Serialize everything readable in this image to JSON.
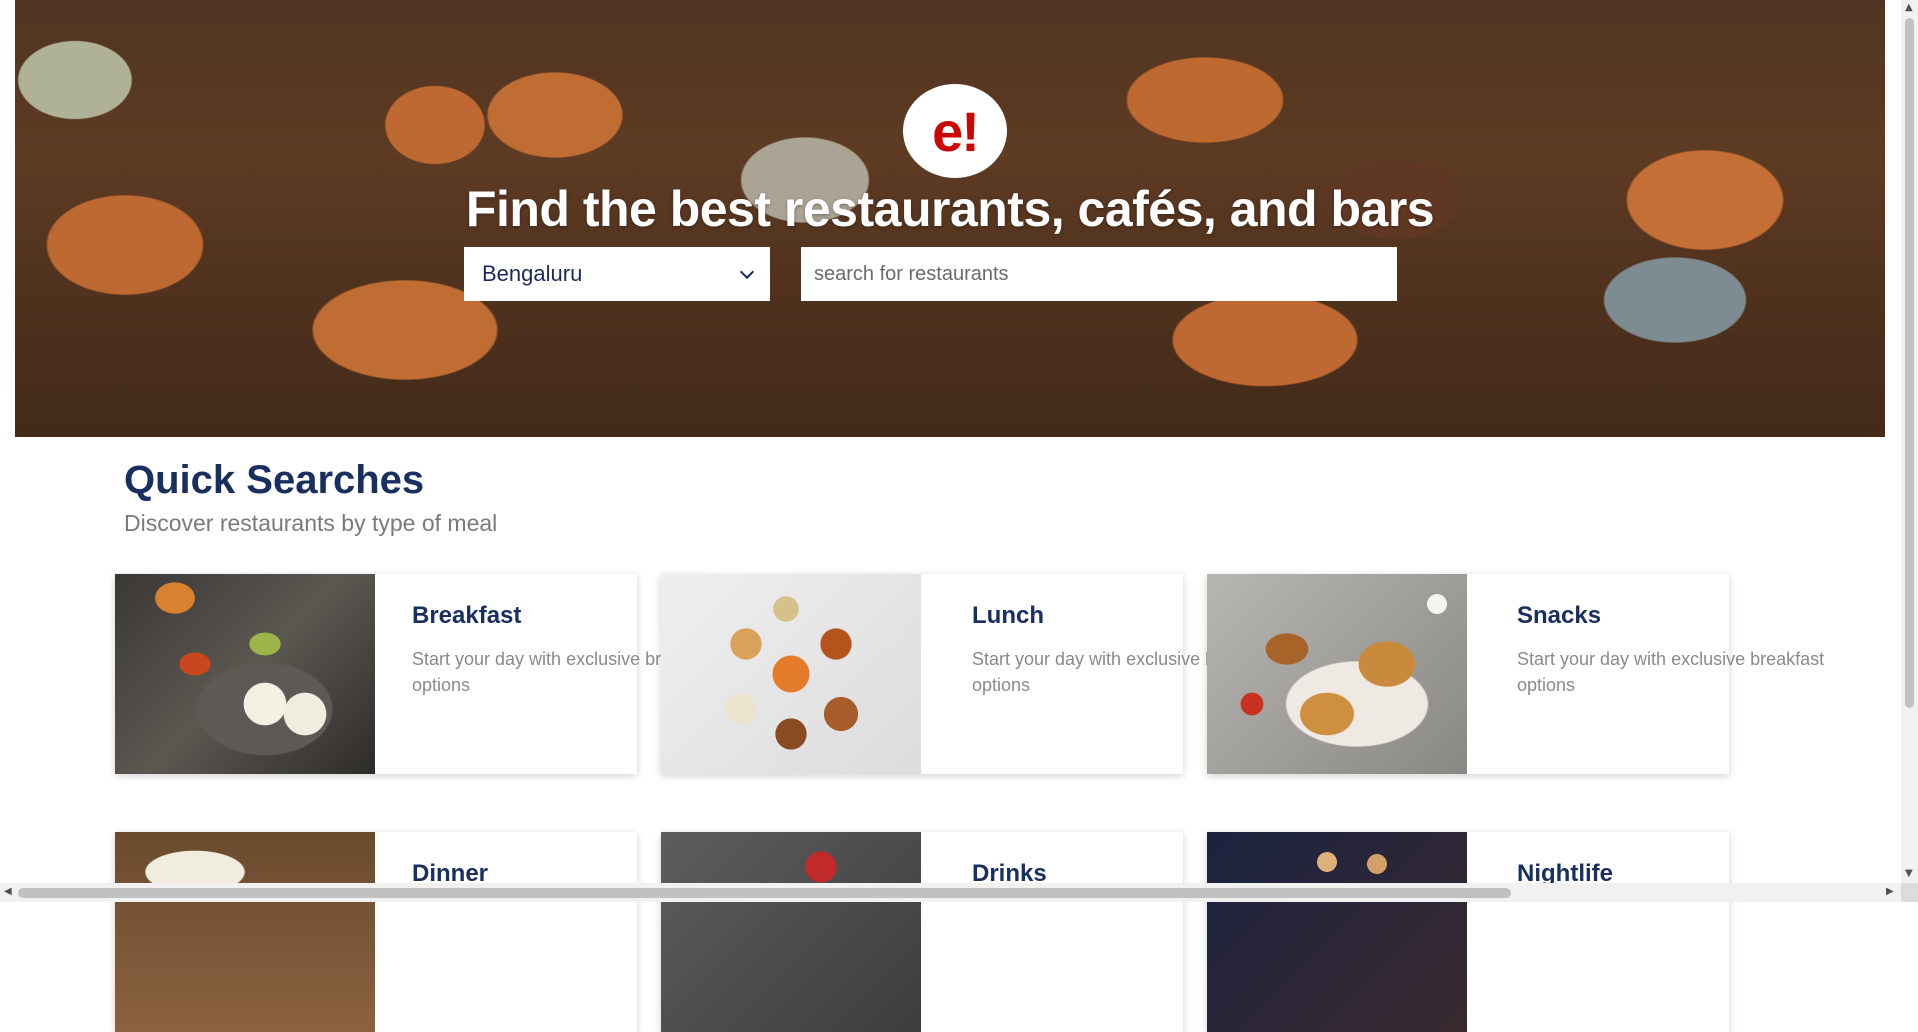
{
  "hero": {
    "logo_text": "e!",
    "headline": "Find the best restaurants, cafés, and bars",
    "location": {
      "selected": "Bengaluru"
    },
    "search": {
      "placeholder": "search for restaurants"
    }
  },
  "quick_searches": {
    "title": "Quick Searches",
    "subtitle": "Discover restaurants by type of meal",
    "cards": [
      {
        "title": "Breakfast",
        "description": "Start your day with exclusive breakfast options"
      },
      {
        "title": "Lunch",
        "description": "Start your day with exclusive breakfast options"
      },
      {
        "title": "Snacks",
        "description": "Start your day with exclusive breakfast options"
      },
      {
        "title": "Dinner",
        "description": ""
      },
      {
        "title": "Drinks",
        "description": ""
      },
      {
        "title": "Nightlife",
        "description": ""
      }
    ]
  },
  "colors": {
    "brand_red": "#ce0505",
    "heading_navy": "#192f60",
    "muted_text": "#8a8a8a"
  }
}
